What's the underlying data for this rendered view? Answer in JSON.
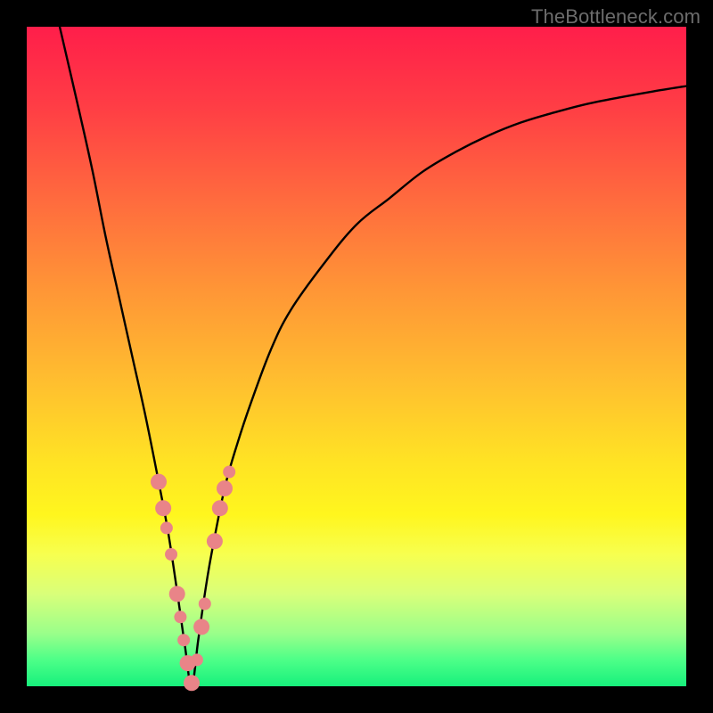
{
  "watermark": "TheBottleneck.com",
  "colors": {
    "background": "#000000",
    "curve": "#000000",
    "marker_fill": "#e98488",
    "gradient_top": "#ff1e4a",
    "gradient_bottom": "#17f07c"
  },
  "chart_data": {
    "type": "line",
    "title": "",
    "xlabel": "",
    "ylabel": "",
    "xlim": [
      0,
      100
    ],
    "ylim": [
      0,
      100
    ],
    "grid": false,
    "legend": false,
    "series": [
      {
        "name": "bottleneck-curve",
        "x": [
          5,
          8,
          10,
          12,
          14,
          16,
          18,
          20,
          21.5,
          23,
          24,
          25,
          26,
          27,
          28,
          30,
          32,
          34,
          37,
          40,
          45,
          50,
          55,
          60,
          65,
          70,
          75,
          80,
          85,
          90,
          95,
          100
        ],
        "y": [
          100,
          87,
          78,
          68,
          59,
          50,
          41,
          31,
          23,
          13,
          6,
          0,
          7,
          14,
          20,
          30,
          37,
          43,
          51,
          57,
          64,
          70,
          74,
          78,
          81,
          83.5,
          85.5,
          87,
          88.3,
          89.3,
          90.2,
          91
        ]
      }
    ],
    "markers": [
      {
        "x": 20.0,
        "y": 31,
        "r": 9
      },
      {
        "x": 20.7,
        "y": 27,
        "r": 9
      },
      {
        "x": 21.2,
        "y": 24,
        "r": 7
      },
      {
        "x": 21.9,
        "y": 20,
        "r": 7
      },
      {
        "x": 22.8,
        "y": 14,
        "r": 9
      },
      {
        "x": 23.3,
        "y": 10.5,
        "r": 7
      },
      {
        "x": 23.8,
        "y": 7,
        "r": 7
      },
      {
        "x": 24.4,
        "y": 3.5,
        "r": 9
      },
      {
        "x": 25.0,
        "y": 0.5,
        "r": 9
      },
      {
        "x": 25.8,
        "y": 4,
        "r": 7
      },
      {
        "x": 26.5,
        "y": 9,
        "r": 9
      },
      {
        "x": 27.0,
        "y": 12.5,
        "r": 7
      },
      {
        "x": 28.5,
        "y": 22,
        "r": 9
      },
      {
        "x": 29.3,
        "y": 27,
        "r": 9
      },
      {
        "x": 30.0,
        "y": 30,
        "r": 9
      },
      {
        "x": 30.7,
        "y": 32.5,
        "r": 7
      }
    ]
  }
}
